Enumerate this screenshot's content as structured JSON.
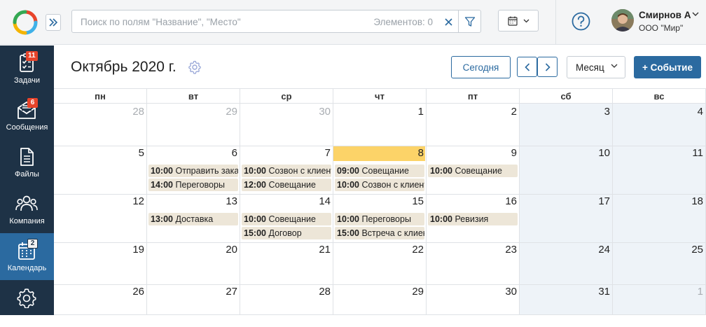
{
  "topbar": {
    "search_placeholder": "Поиск по полям \"Название\", \"Место\"",
    "search_count": "Элементов: 0",
    "user_name": "Смирнов А",
    "user_org": "ООО \"Мир\""
  },
  "sidebar": {
    "items": [
      {
        "label": "Задачи",
        "badge": "11",
        "icon": "tasks-icon"
      },
      {
        "label": "Сообщения",
        "badge": "6",
        "icon": "messages-icon"
      },
      {
        "label": "Файлы",
        "badge": "",
        "icon": "files-icon"
      },
      {
        "label": "Компания",
        "badge": "",
        "icon": "company-icon"
      },
      {
        "label": "Календарь",
        "badge": "2",
        "icon": "calendar-icon"
      },
      {
        "label": "",
        "badge": "",
        "icon": "settings-icon"
      }
    ]
  },
  "calendar": {
    "title": "Октябрь 2020 г.",
    "today_label": "Сегодня",
    "view_label": "Месяц",
    "add_event_label": "+ Событие",
    "weekdays": [
      "пн",
      "вт",
      "ср",
      "чт",
      "пт",
      "сб",
      "вс"
    ],
    "weeks": [
      [
        {
          "day": "28",
          "muted": true,
          "events": []
        },
        {
          "day": "29",
          "muted": true,
          "events": []
        },
        {
          "day": "30",
          "muted": true,
          "events": []
        },
        {
          "day": "1",
          "events": []
        },
        {
          "day": "2",
          "events": []
        },
        {
          "day": "3",
          "events": []
        },
        {
          "day": "4",
          "events": []
        }
      ],
      [
        {
          "day": "5",
          "events": []
        },
        {
          "day": "6",
          "events": [
            {
              "time": "10:00",
              "title": "Отправить заказ"
            },
            {
              "time": "14:00",
              "title": "Переговоры"
            }
          ]
        },
        {
          "day": "7",
          "events": [
            {
              "time": "10:00",
              "title": "Созвон с клиентом"
            },
            {
              "time": "12:00",
              "title": "Совещание"
            }
          ]
        },
        {
          "day": "8",
          "today": true,
          "events": [
            {
              "time": "09:00",
              "title": "Совещание"
            },
            {
              "time": "10:00",
              "title": "Созвон с клиентом"
            }
          ]
        },
        {
          "day": "9",
          "events": [
            {
              "time": "10:00",
              "title": "Совещание"
            }
          ]
        },
        {
          "day": "10",
          "events": []
        },
        {
          "day": "11",
          "events": []
        }
      ],
      [
        {
          "day": "12",
          "events": []
        },
        {
          "day": "13",
          "events": [
            {
              "time": "13:00",
              "title": "Доставка"
            }
          ]
        },
        {
          "day": "14",
          "events": [
            {
              "time": "10:00",
              "title": "Совещание"
            },
            {
              "time": "15:00",
              "title": "Договор"
            }
          ]
        },
        {
          "day": "15",
          "events": [
            {
              "time": "10:00",
              "title": "Переговоры"
            },
            {
              "time": "15:00",
              "title": "Встреча с клиентом"
            }
          ]
        },
        {
          "day": "16",
          "events": [
            {
              "time": "10:00",
              "title": "Ревизия"
            }
          ]
        },
        {
          "day": "17",
          "events": []
        },
        {
          "day": "18",
          "events": []
        }
      ],
      [
        {
          "day": "19",
          "events": []
        },
        {
          "day": "20",
          "events": []
        },
        {
          "day": "21",
          "events": []
        },
        {
          "day": "22",
          "events": []
        },
        {
          "day": "23",
          "events": []
        },
        {
          "day": "24",
          "events": []
        },
        {
          "day": "25",
          "events": []
        }
      ],
      [
        {
          "day": "26",
          "events": []
        },
        {
          "day": "27",
          "events": []
        },
        {
          "day": "28",
          "events": []
        },
        {
          "day": "29",
          "events": []
        },
        {
          "day": "30",
          "events": []
        },
        {
          "day": "31",
          "events": []
        },
        {
          "day": "1",
          "muted": true,
          "events": []
        }
      ]
    ]
  },
  "colors": {
    "sidebar_bg": "#1e3246",
    "sidebar_active": "#2b6aa0",
    "accent": "#2b6aa0",
    "badge": "#e8442b",
    "today_highlight": "#fcd368",
    "event_bg": "#ede6d8",
    "weekend_bg": "#eef3f8"
  }
}
